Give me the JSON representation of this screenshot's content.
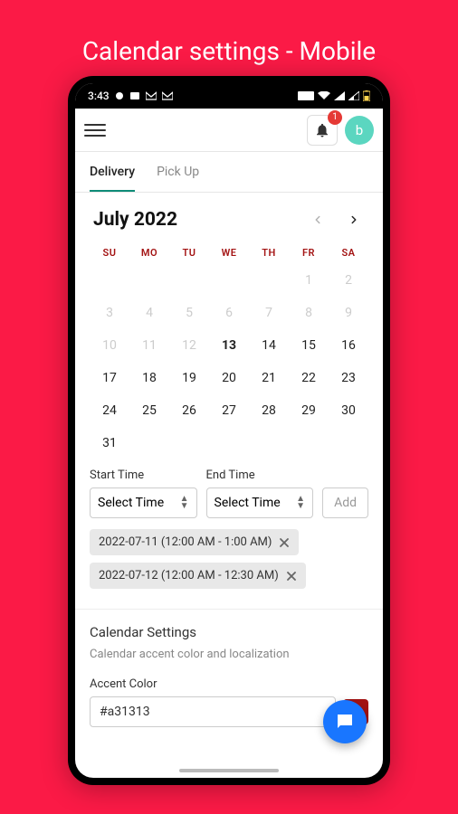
{
  "page": {
    "title": "Calendar settings - Mobile"
  },
  "statusbar": {
    "time": "3:43"
  },
  "header": {
    "notification_count": "1",
    "avatar_initial": "b"
  },
  "tabs": {
    "delivery": "Delivery",
    "pickup": "Pick Up"
  },
  "calendar": {
    "title": "July 2022",
    "dow": [
      "SU",
      "MO",
      "TU",
      "WE",
      "TH",
      "FR",
      "SA"
    ],
    "weeks": [
      [
        {
          "d": "",
          "muted": true
        },
        {
          "d": "",
          "muted": true
        },
        {
          "d": "",
          "muted": true
        },
        {
          "d": "",
          "muted": true
        },
        {
          "d": "",
          "muted": true
        },
        {
          "d": "1",
          "muted": true
        },
        {
          "d": "2",
          "muted": true
        }
      ],
      [
        {
          "d": "3",
          "muted": true
        },
        {
          "d": "4",
          "muted": true
        },
        {
          "d": "5",
          "muted": true
        },
        {
          "d": "6",
          "muted": true
        },
        {
          "d": "7",
          "muted": true
        },
        {
          "d": "8",
          "muted": true
        },
        {
          "d": "9",
          "muted": true
        }
      ],
      [
        {
          "d": "10",
          "muted": true
        },
        {
          "d": "11",
          "muted": true
        },
        {
          "d": "12",
          "muted": true
        },
        {
          "d": "13",
          "today": true
        },
        {
          "d": "14"
        },
        {
          "d": "15"
        },
        {
          "d": "16"
        }
      ],
      [
        {
          "d": "17"
        },
        {
          "d": "18"
        },
        {
          "d": "19"
        },
        {
          "d": "20"
        },
        {
          "d": "21"
        },
        {
          "d": "22"
        },
        {
          "d": "23"
        }
      ],
      [
        {
          "d": "24"
        },
        {
          "d": "25"
        },
        {
          "d": "26"
        },
        {
          "d": "27"
        },
        {
          "d": "28"
        },
        {
          "d": "29"
        },
        {
          "d": "30"
        }
      ],
      [
        {
          "d": "31"
        },
        {
          "d": ""
        },
        {
          "d": ""
        },
        {
          "d": ""
        },
        {
          "d": ""
        },
        {
          "d": ""
        },
        {
          "d": ""
        }
      ]
    ]
  },
  "times": {
    "start_label": "Start Time",
    "end_label": "End Time",
    "placeholder": "Select Time",
    "add_label": "Add"
  },
  "chips": [
    "2022-07-11 (12:00 AM - 1:00 AM)",
    "2022-07-12 (12:00 AM - 12:30 AM)"
  ],
  "settings": {
    "title": "Calendar Settings",
    "desc": "Calendar accent color and localization",
    "accent_label": "Accent Color",
    "accent_value": "#a31313"
  }
}
